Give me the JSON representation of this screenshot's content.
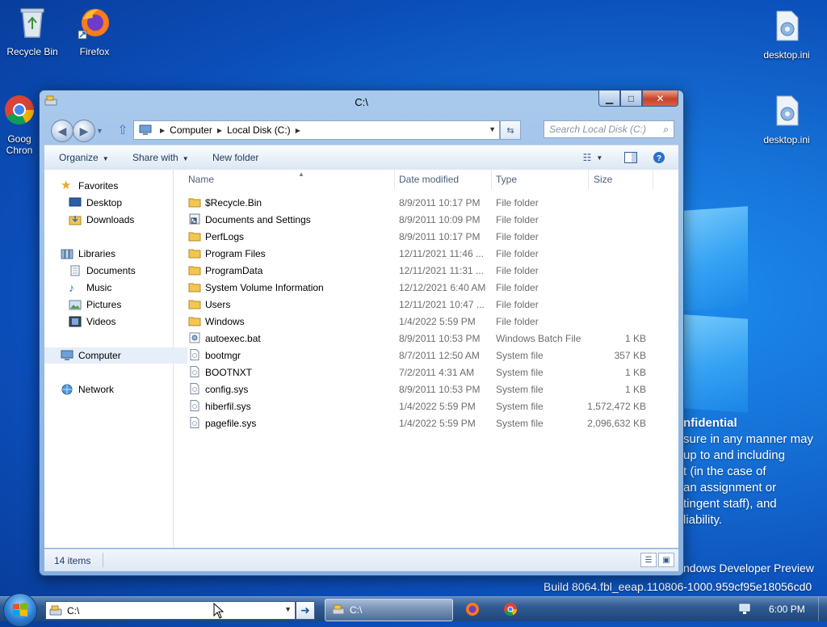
{
  "desktop": {
    "icons": [
      {
        "label": "Recycle Bin"
      },
      {
        "label": "Firefox"
      },
      {
        "label": "Goog Chron"
      },
      {
        "label": "desktop.ini"
      },
      {
        "label": "desktop.ini"
      }
    ],
    "watermark": {
      "heading": "nfidential",
      "lines": [
        "sure in any manner may",
        "up to and including",
        "t (in the case of",
        "an assignment or",
        "tingent staff), and",
        "liability."
      ]
    },
    "edition": "ndows Developer Preview",
    "build": "Build 8064.fbl_eeap.110806-1000.959cf95e18056cd0"
  },
  "window": {
    "title": "C:\\",
    "breadcrumb": [
      "Computer",
      "Local Disk (C:)"
    ],
    "search_placeholder": "Search Local Disk (C:)",
    "toolbar": {
      "organize": "Organize",
      "share_with": "Share with",
      "new_folder": "New folder"
    },
    "nav": {
      "favorites": "Favorites",
      "favorites_items": [
        "Desktop",
        "Downloads"
      ],
      "libraries": "Libraries",
      "libraries_items": [
        "Documents",
        "Music",
        "Pictures",
        "Videos"
      ],
      "computer": "Computer",
      "network": "Network"
    },
    "columns": {
      "name": "Name",
      "date": "Date modified",
      "type": "Type",
      "size": "Size"
    },
    "files": [
      {
        "name": "$Recycle.Bin",
        "date": "8/9/2011 10:17 PM",
        "type": "File folder",
        "size": "",
        "kind": "folder"
      },
      {
        "name": "Documents and Settings",
        "date": "8/9/2011 10:09 PM",
        "type": "File folder",
        "size": "",
        "kind": "link"
      },
      {
        "name": "PerfLogs",
        "date": "8/9/2011 10:17 PM",
        "type": "File folder",
        "size": "",
        "kind": "folder"
      },
      {
        "name": "Program Files",
        "date": "12/11/2021 11:46 ...",
        "type": "File folder",
        "size": "",
        "kind": "folder"
      },
      {
        "name": "ProgramData",
        "date": "12/11/2021 11:31 ...",
        "type": "File folder",
        "size": "",
        "kind": "folder"
      },
      {
        "name": "System Volume Information",
        "date": "12/12/2021 6:40 AM",
        "type": "File folder",
        "size": "",
        "kind": "folder"
      },
      {
        "name": "Users",
        "date": "12/11/2021 10:47 ...",
        "type": "File folder",
        "size": "",
        "kind": "folder"
      },
      {
        "name": "Windows",
        "date": "1/4/2022 5:59 PM",
        "type": "File folder",
        "size": "",
        "kind": "folder"
      },
      {
        "name": "autoexec.bat",
        "date": "8/9/2011 10:53 PM",
        "type": "Windows Batch File",
        "size": "1 KB",
        "kind": "bat"
      },
      {
        "name": "bootmgr",
        "date": "8/7/2011 12:50 AM",
        "type": "System file",
        "size": "357 KB",
        "kind": "file"
      },
      {
        "name": "BOOTNXT",
        "date": "7/2/2011 4:31 AM",
        "type": "System file",
        "size": "1 KB",
        "kind": "file"
      },
      {
        "name": "config.sys",
        "date": "8/9/2011 10:53 PM",
        "type": "System file",
        "size": "1 KB",
        "kind": "file"
      },
      {
        "name": "hiberfil.sys",
        "date": "1/4/2022 5:59 PM",
        "type": "System file",
        "size": "1,572,472 KB",
        "kind": "file"
      },
      {
        "name": "pagefile.sys",
        "date": "1/4/2022 5:59 PM",
        "type": "System file",
        "size": "2,096,632 KB",
        "kind": "file"
      }
    ],
    "status": "14 items"
  },
  "taskbar": {
    "run_value": "C:\\",
    "task_label": "C:\\",
    "clock": "6:00 PM"
  },
  "colors": {
    "folder": "#f3c74f",
    "accent": "#1c58b3"
  }
}
